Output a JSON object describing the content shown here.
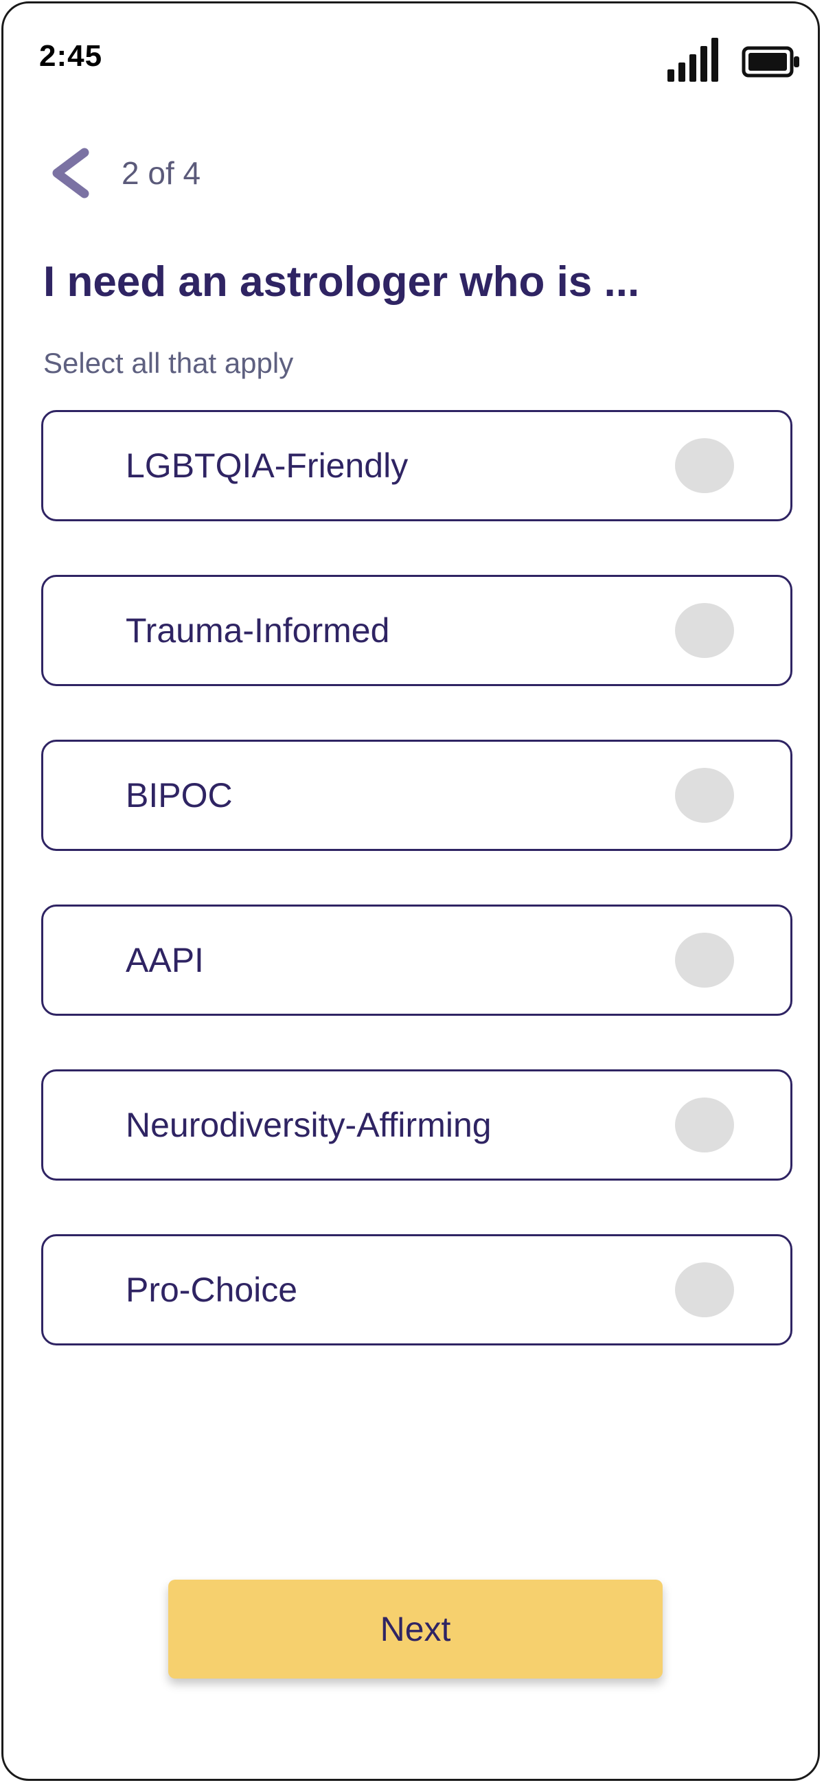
{
  "status_bar": {
    "time": "2:45",
    "signal_icon": "cellular-signal-icon",
    "battery_icon": "battery-icon"
  },
  "header": {
    "back_icon": "chevron-left-icon",
    "step": "2 of 4"
  },
  "title": "I need an astrologer who is ...",
  "subtitle": "Select all that apply",
  "options": [
    {
      "label": "LGBTQIA-Friendly",
      "selected": false
    },
    {
      "label": "Trauma-Informed",
      "selected": false
    },
    {
      "label": "BIPOC",
      "selected": false
    },
    {
      "label": "AAPI",
      "selected": false
    },
    {
      "label": "Neurodiversity-Affirming",
      "selected": false
    },
    {
      "label": "Pro-Choice",
      "selected": false
    }
  ],
  "next_label": "Next",
  "colors": {
    "primary_text": "#2f2463",
    "accent_button": "#f6d06e",
    "radio_unselected": "#dedede",
    "back_icon": "#7b72a3"
  }
}
